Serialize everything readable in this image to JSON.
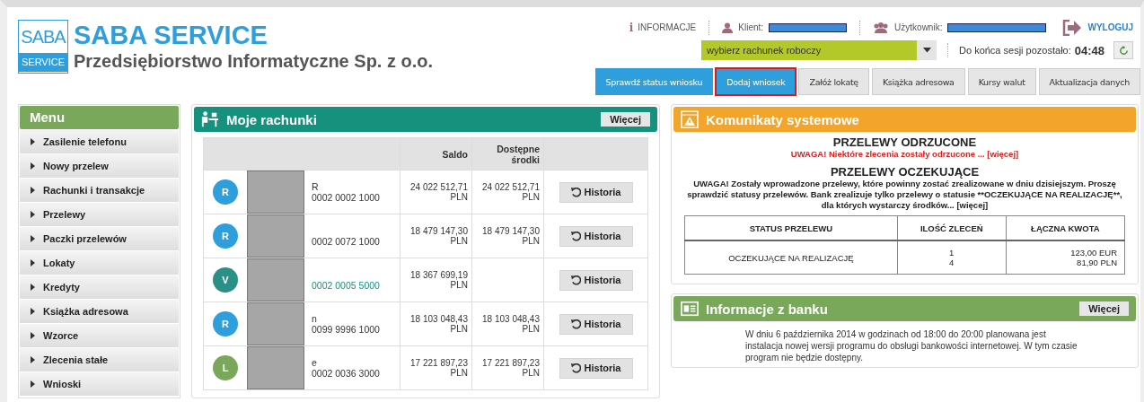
{
  "header": {
    "logo_top": "SABA",
    "logo_bottom": "SERVICE",
    "title": "SABA SERVICE",
    "subtitle": "Przedsiębiorstwo Informatyczne Sp. z o.o.",
    "info_link": "INFORMACJE",
    "info_icon": "i",
    "client_label": "Klient:",
    "user_label": "Użytkownik:",
    "logout": "WYLOGUJ",
    "account_select": {
      "value": "wybierz rachunek roboczy"
    },
    "session_label": "Do końca sesji pozostało:",
    "session_time": "04:48"
  },
  "tabs": [
    {
      "label": "Sprawdź status wniosku",
      "selected": true,
      "highlighted": false
    },
    {
      "label": "Dodaj wniosek",
      "selected": true,
      "highlighted": true
    },
    {
      "label": "Załóż lokatę",
      "selected": false,
      "highlighted": false
    },
    {
      "label": "Książka adresowa",
      "selected": false,
      "highlighted": false
    },
    {
      "label": "Kursy walut",
      "selected": false,
      "highlighted": false
    },
    {
      "label": "Aktualizacja danych",
      "selected": false,
      "highlighted": false
    }
  ],
  "sidebar": {
    "title": "Menu",
    "items": [
      "Zasilenie telefonu",
      "Nowy przelew",
      "Rachunki i transakcje",
      "Przelewy",
      "Paczki przelewów",
      "Lokaty",
      "Kredyty",
      "Książka adresowa",
      "Wzorce",
      "Zlecenia stałe",
      "Wnioski"
    ]
  },
  "accounts": {
    "title": "Moje rachunki",
    "more": "Więcej",
    "columns": [
      "Saldo",
      "Dostępne środki"
    ],
    "rows": [
      {
        "initial": "R",
        "color": "#2e9fdc",
        "name_tail": "R",
        "number": "0002 0002 1000",
        "link": false,
        "balance": "24 022 512,71 PLN",
        "available": "24 022 512,71 PLN",
        "action": "Historia"
      },
      {
        "initial": "R",
        "color": "#2e9fdc",
        "name_tail": "",
        "number": "0002 0072 1000",
        "link": false,
        "balance": "18 479 147,30 PLN",
        "available": "18 479 147,30 PLN",
        "action": "Historia"
      },
      {
        "initial": "V",
        "color": "#2a8f86",
        "name_tail": "",
        "number": "0002 0005 5000",
        "link": true,
        "balance": "18 367 699,19 PLN",
        "available": "",
        "action": "Historia"
      },
      {
        "initial": "R",
        "color": "#2e9fdc",
        "name_tail": "n",
        "number": "0099 9996 1000",
        "link": false,
        "balance": "18 103 048,43 PLN",
        "available": "18 103 048,43 PLN",
        "action": "Historia"
      },
      {
        "initial": "L",
        "color": "#7aa85a",
        "name_tail": "e",
        "number": "0002 0036 3000",
        "link": false,
        "balance": "17 221 897,23 PLN",
        "available": "17 221 897,23 PLN",
        "action": "Historia"
      }
    ]
  },
  "messages": {
    "title": "Komunikaty systemowe",
    "rejected_heading": "PRZELEWY ODRZUCONE",
    "rejected_text": "UWAGA! Niektóre zlecenia zostały odrzucone ... [więcej]",
    "pending_heading": "PRZELEWY OCZEKUJĄCE",
    "pending_text": "UWAGA! Zostały wprowadzone przelewy, które powinny zostać zrealizowane w dniu dzisiejszym. Proszę sprawdzić statusy przelewów. Bank zrealizuje tylko przelewy o statusie **OCZEKUJĄCE NA REALIZACJĘ**, dla których wystarczy środków... [więcej]",
    "table": {
      "columns": [
        "STATUS PRZELEWU",
        "ILOŚĆ ZLECEŃ",
        "ŁĄCZNA KWOTA"
      ],
      "rows": [
        {
          "status": "OCZEKUJĄCE NA REALIZACJĘ",
          "counts": [
            "1",
            "4"
          ],
          "amounts": [
            "123,00 EUR",
            "81,90 PLN"
          ]
        }
      ]
    }
  },
  "news": {
    "title": "Informacje z banku",
    "more": "Więcej",
    "text": "W dniu 6 października 2014 w godzinach od 18:00 do 20:00 planowana jest instalacja nowej wersji programu do obsługi bankowości internetowej. W tym czasie program nie będzie dostępny."
  }
}
